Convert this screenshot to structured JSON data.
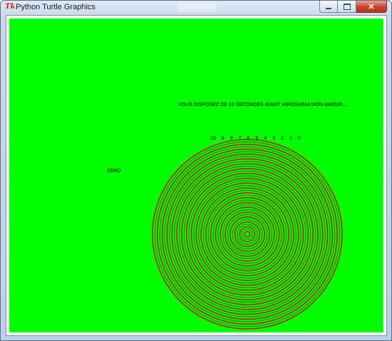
{
  "window": {
    "title": "Python Turtle Graphics",
    "icon": "tk-feather-icon",
    "controls": {
      "minimize": "minimize-icon",
      "maximize": "maximize-icon",
      "close": "close-icon"
    }
  },
  "canvas": {
    "background": "#00ff00",
    "message": "VOUS DISPOSEZ DE 10 SECONDES AVANT HIROSHIMA MON AMOUR....",
    "countdown": [
      "10",
      "9",
      "8",
      "7",
      "6",
      "5",
      "4",
      "3",
      "2",
      "1",
      "0"
    ],
    "zero_label": "ZERO",
    "spiral_colors": {
      "primary": "#d4151f",
      "secondary": "#1f8a14"
    }
  }
}
